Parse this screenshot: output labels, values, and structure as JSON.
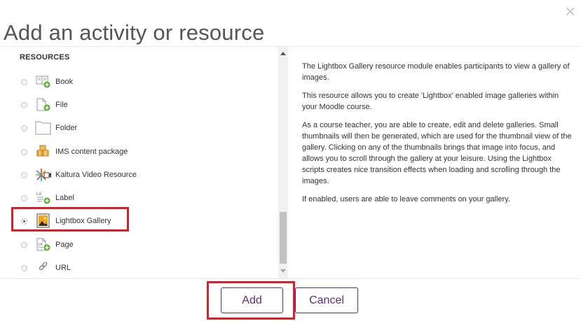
{
  "dialog": {
    "title": "Add an activity or resource",
    "close_symbol": "×"
  },
  "chooser": {
    "section_title": "RESOURCES",
    "items": [
      {
        "label": "Book",
        "icon": "book-icon",
        "selected": false
      },
      {
        "label": "File",
        "icon": "file-icon",
        "selected": false
      },
      {
        "label": "Folder",
        "icon": "folder-icon",
        "selected": false
      },
      {
        "label": "IMS content package",
        "icon": "ims-package-icon",
        "selected": false
      },
      {
        "label": "Kaltura Video Resource",
        "icon": "kaltura-video-icon",
        "selected": false
      },
      {
        "label": "Label",
        "icon": "label-icon",
        "selected": false
      },
      {
        "label": "Lightbox Gallery",
        "icon": "lightbox-gallery-icon",
        "selected": true
      },
      {
        "label": "Page",
        "icon": "page-icon",
        "selected": false
      },
      {
        "label": "URL",
        "icon": "url-icon",
        "selected": false
      }
    ]
  },
  "description": {
    "paragraphs": [
      "The Lightbox Gallery resource module enables participants to view a gallery of images.",
      "This resource allows you to create 'Lightbox' enabled image galleries within your Moodle course.",
      "As a course teacher, you are able to create, edit and delete galleries. Small thumbnails will then be generated, which are used for the thumbnail view of the gallery. Clicking on any of the thumbnails brings that image into focus, and allows you to scroll through the gallery at your leisure. Using the Lightbox scripts creates nice transition effects when loading and scrolling through the images.",
      "If enabled, users are able to leave comments on your gallery."
    ]
  },
  "footer": {
    "add_label": "Add",
    "cancel_label": "Cancel"
  },
  "colors": {
    "accent": "#5d2d79",
    "highlight": "#d3222a"
  }
}
